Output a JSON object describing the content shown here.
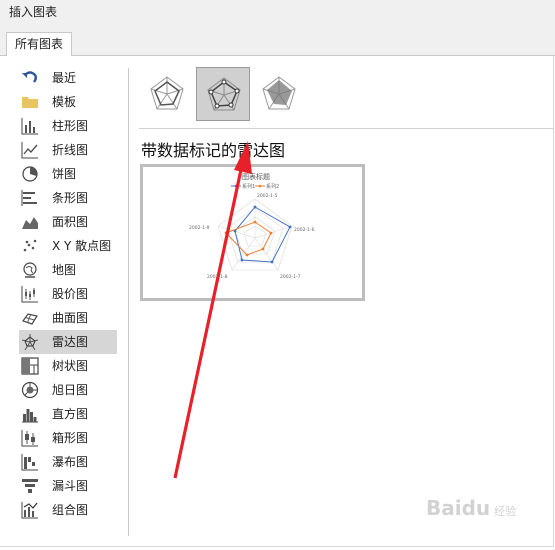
{
  "window": {
    "title": "插入图表"
  },
  "tabs": [
    {
      "label": "所有图表"
    }
  ],
  "sidebar": {
    "items": [
      {
        "label": "最近",
        "icon": "undo-arrow-icon"
      },
      {
        "label": "模板",
        "icon": "folder-icon"
      },
      {
        "label": "柱形图",
        "icon": "column-chart-icon"
      },
      {
        "label": "折线图",
        "icon": "line-chart-icon"
      },
      {
        "label": "饼图",
        "icon": "pie-chart-icon"
      },
      {
        "label": "条形图",
        "icon": "bar-chart-icon"
      },
      {
        "label": "面积图",
        "icon": "area-chart-icon"
      },
      {
        "label": "X Y 散点图",
        "icon": "scatter-chart-icon"
      },
      {
        "label": "地图",
        "icon": "map-chart-icon"
      },
      {
        "label": "股价图",
        "icon": "stock-chart-icon"
      },
      {
        "label": "曲面图",
        "icon": "surface-chart-icon"
      },
      {
        "label": "雷达图",
        "icon": "radar-chart-icon",
        "selected": true
      },
      {
        "label": "树状图",
        "icon": "treemap-chart-icon"
      },
      {
        "label": "旭日图",
        "icon": "sunburst-chart-icon"
      },
      {
        "label": "直方图",
        "icon": "histogram-chart-icon"
      },
      {
        "label": "箱形图",
        "icon": "box-whisker-chart-icon"
      },
      {
        "label": "瀑布图",
        "icon": "waterfall-chart-icon"
      },
      {
        "label": "漏斗图",
        "icon": "funnel-chart-icon"
      },
      {
        "label": "组合图",
        "icon": "combo-chart-icon"
      }
    ]
  },
  "subtypes": [
    {
      "name": "radar",
      "icon": "radar-icon"
    },
    {
      "name": "radar-with-markers",
      "icon": "radar-markers-icon",
      "selected": true
    },
    {
      "name": "filled-radar",
      "icon": "filled-radar-icon"
    }
  ],
  "main": {
    "subtype_title": "带数据标记的雷达图"
  },
  "preview": {
    "chart_title": "图表标题",
    "legend": [
      "系列1",
      "系列2"
    ],
    "axis_labels": [
      "2002-1-5",
      "2002-1-6",
      "2002-1-7",
      "2002-1-8",
      "2002-1-9"
    ]
  },
  "colors": {
    "series1": "#4472c4",
    "series2": "#ed7d31",
    "arrow": "#e8202a",
    "selected_bg": "#d6d6d6"
  },
  "watermark": {
    "brand": "Baidu",
    "suffix": "经验"
  }
}
